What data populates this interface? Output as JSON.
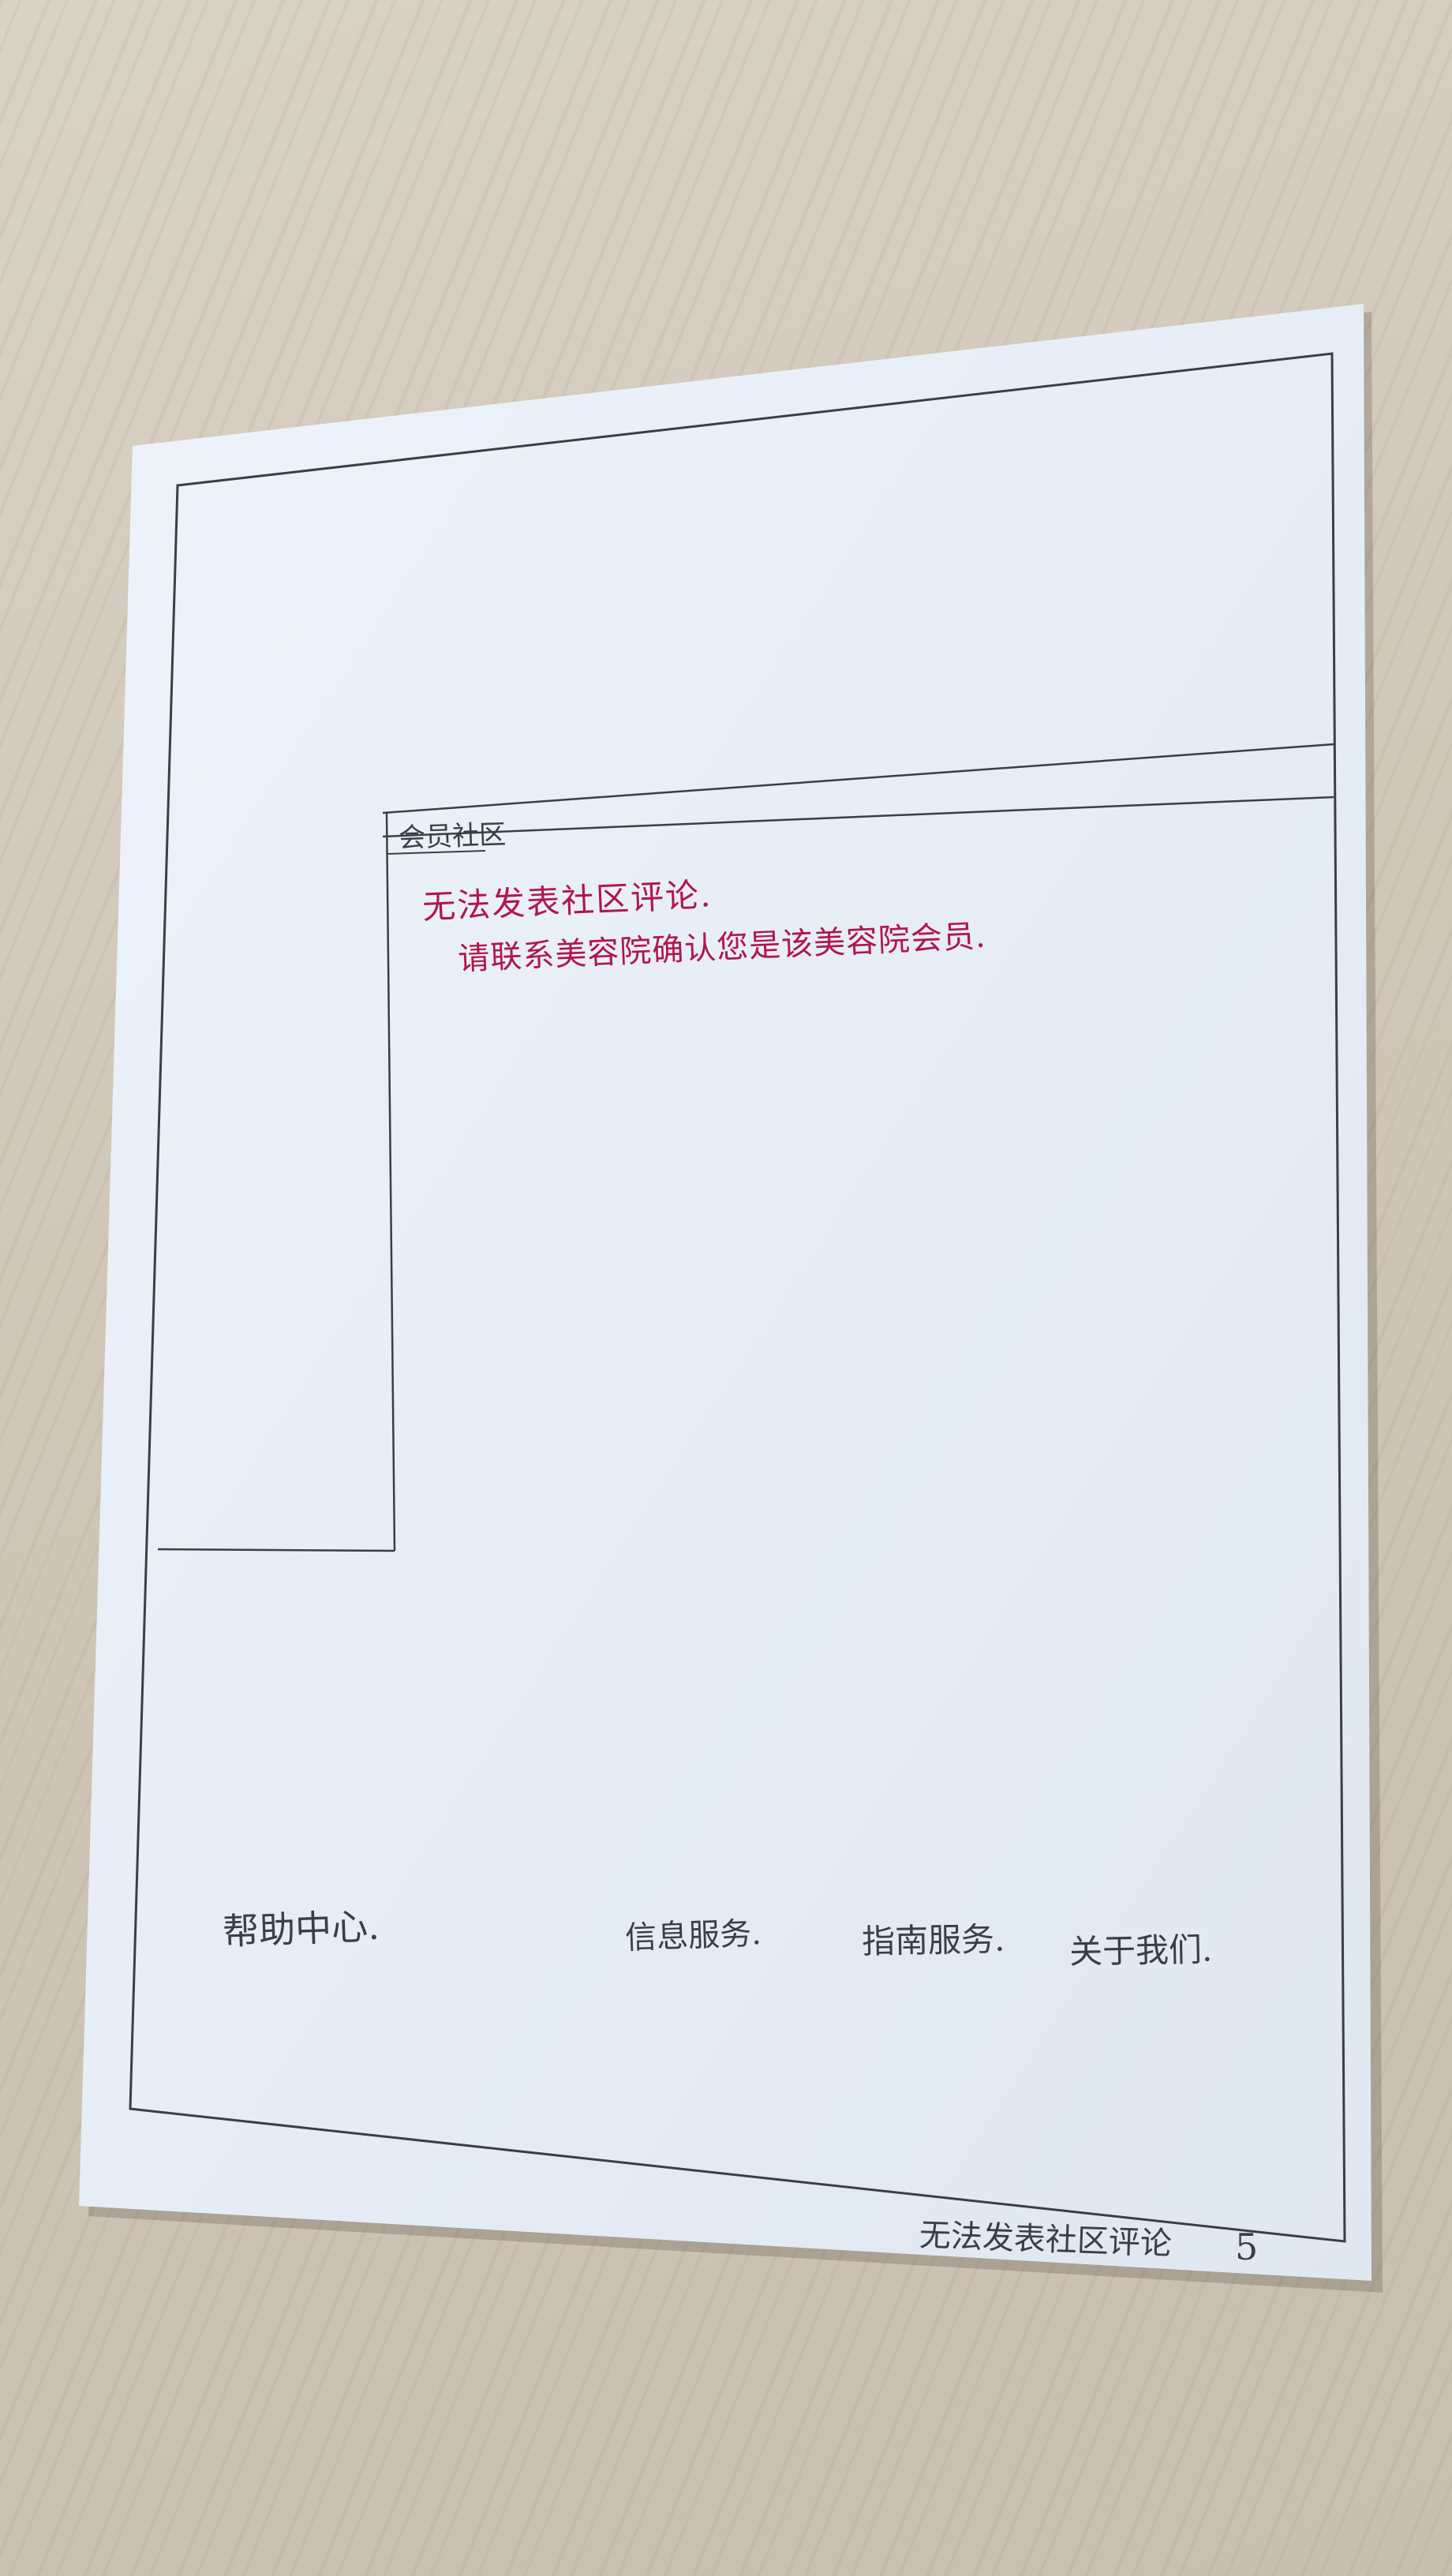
{
  "sketch": {
    "panel_title": "会员社区",
    "message_line1": "无法发表社区评论.",
    "message_line2": "请联系美容院确认您是该美容院会员.",
    "footer_links": [
      {
        "label": "帮助中心."
      },
      {
        "label": "信息服务."
      },
      {
        "label": "指南服务."
      },
      {
        "label": "关于我们."
      }
    ],
    "page_caption": "无法发表社区评论",
    "page_number": "5"
  },
  "colors": {
    "pencil": "#3a3f47",
    "ink": "#b0174a",
    "paper": "#e8eef6"
  }
}
